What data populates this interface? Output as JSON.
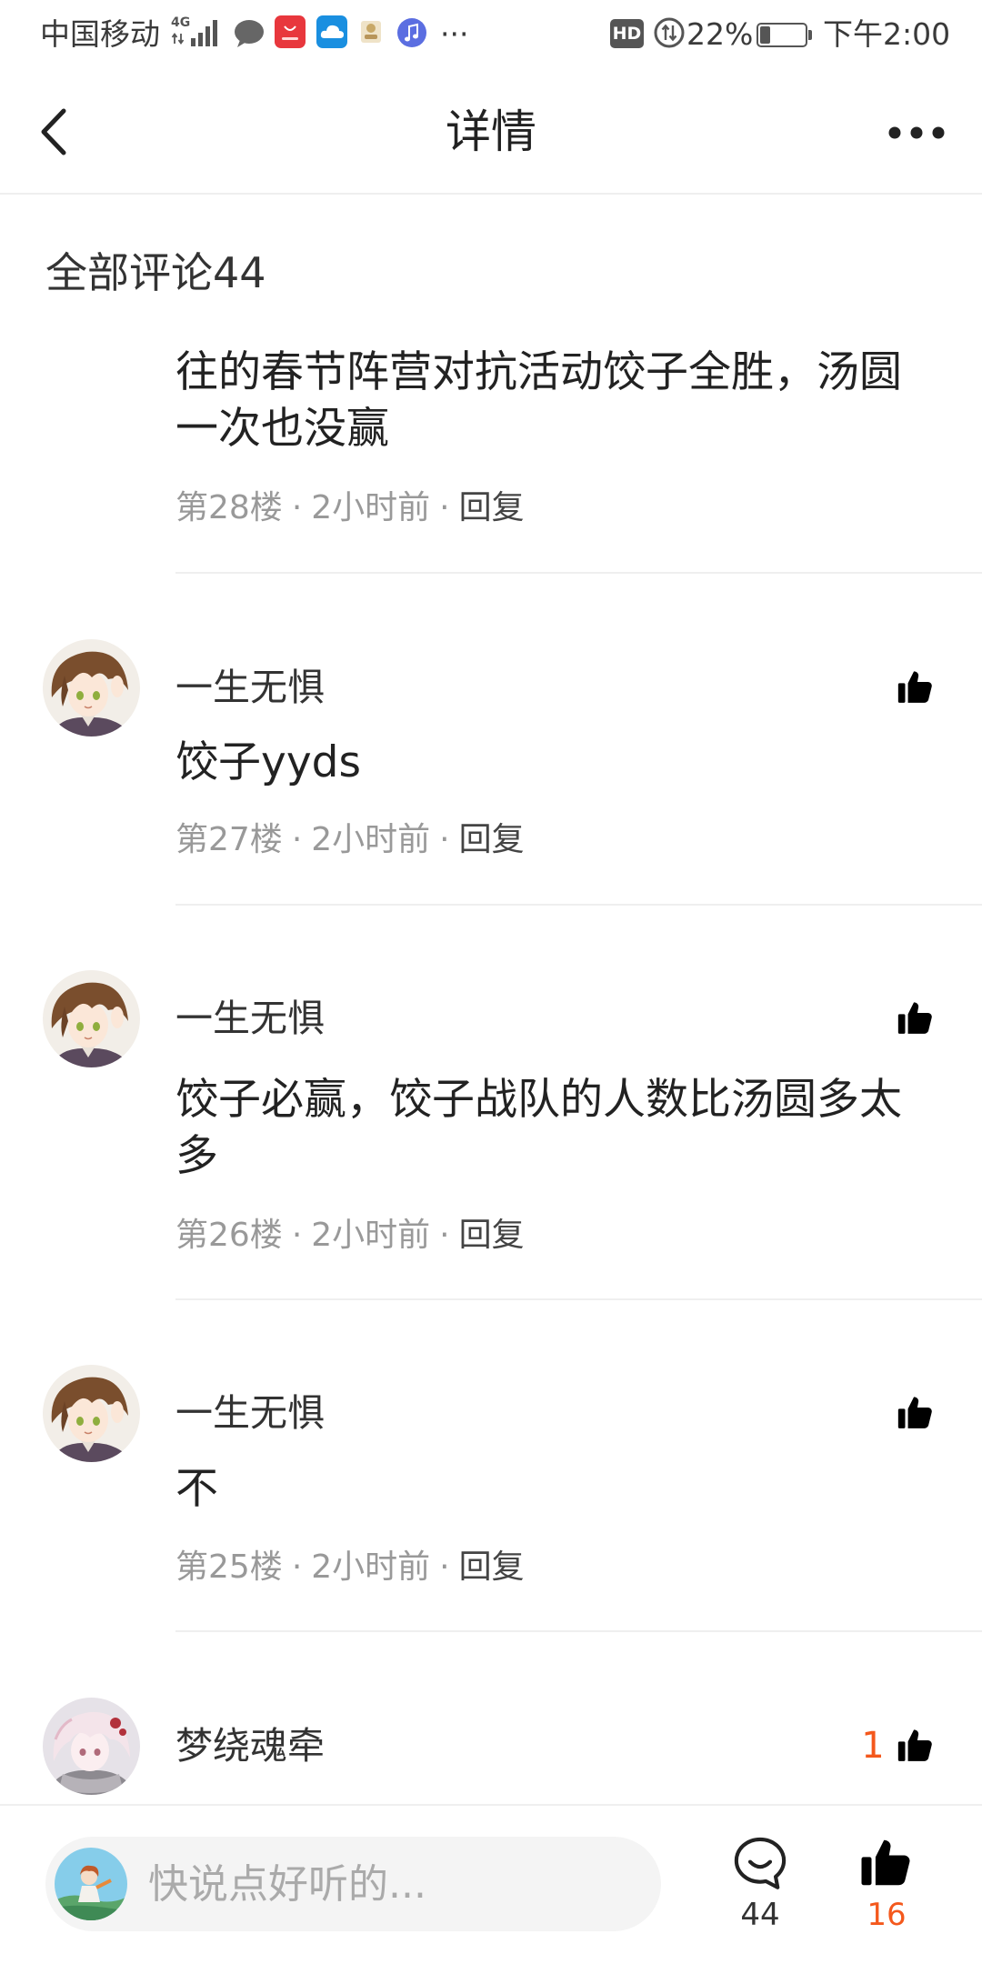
{
  "status_bar": {
    "carrier": "中国移动",
    "network": "4G",
    "more": "···",
    "hd": "HD",
    "battery_percent": "22%",
    "battery_level": 0.22,
    "time": "下午2:00"
  },
  "header": {
    "title": "详情"
  },
  "comments_header": {
    "label": "全部评论44"
  },
  "meta_separator": "·",
  "comments": [
    {
      "content": "往的春节阵营对抗活动饺子全胜，汤圆一次也没赢",
      "floor": "第28楼",
      "time": "2小时前",
      "reply": "回复"
    },
    {
      "user": "一生无惧",
      "content": "饺子yyds",
      "floor": "第27楼",
      "time": "2小时前",
      "reply": "回复",
      "liked": false
    },
    {
      "user": "一生无惧",
      "content": "饺子必赢，饺子战队的人数比汤圆多太多",
      "floor": "第26楼",
      "time": "2小时前",
      "reply": "回复",
      "liked": false
    },
    {
      "user": "一生无惧",
      "content": "不",
      "floor": "第25楼",
      "time": "2小时前",
      "reply": "回复",
      "liked": false
    },
    {
      "user": "梦绕魂牵",
      "like_count": "1",
      "liked": true
    }
  ],
  "bottom_bar": {
    "input_placeholder": "快说点好听的...",
    "comment_count": "44",
    "like_count": "16",
    "liked": true
  },
  "colors": {
    "accent": "#F4581C",
    "text_primary": "#222222",
    "text_secondary": "#999999",
    "divider": "#EFEFEF"
  },
  "icons": {
    "back": "back-arrow-icon",
    "more": "more-icon",
    "like": "thumbs-up-icon",
    "comment": "comment-bubble-icon",
    "notifications": [
      "message-icon",
      "huawei-appgallery-icon",
      "weather-icon",
      "stamp-icon",
      "music-icon"
    ]
  }
}
